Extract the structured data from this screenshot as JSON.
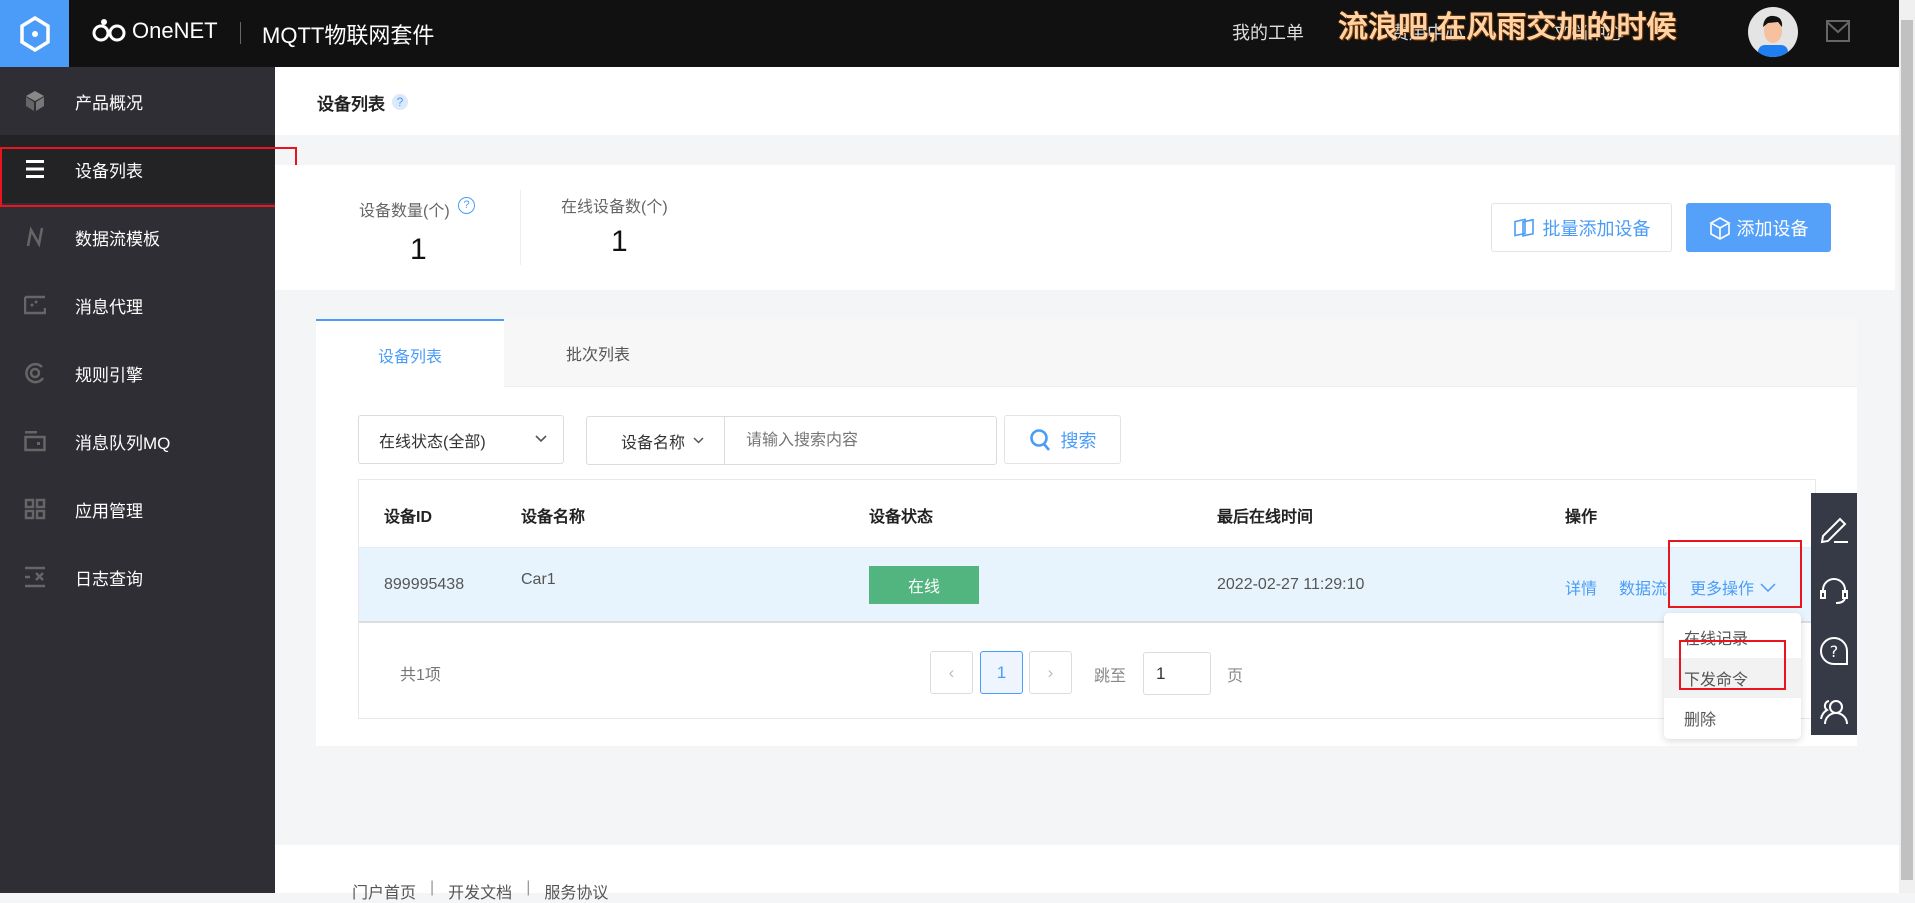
{
  "header": {
    "logo_text": "OneNET",
    "product": "MQTT物联网套件",
    "nav": [
      "我的工单",
      "费用中心",
      "文档中心"
    ],
    "overlay_lyric": "流浪吧,在风雨交加的时候"
  },
  "sidebar": {
    "items": [
      {
        "label": "产品概况",
        "icon": "cube-icon"
      },
      {
        "label": "设备列表",
        "icon": "list-icon"
      },
      {
        "label": "数据流模板",
        "icon": "datastream-icon"
      },
      {
        "label": "消息代理",
        "icon": "message-broker-icon"
      },
      {
        "label": "规则引擎",
        "icon": "rule-engine-icon"
      },
      {
        "label": "消息队列MQ",
        "icon": "queue-icon"
      },
      {
        "label": "应用管理",
        "icon": "apps-grid-icon"
      },
      {
        "label": "日志查询",
        "icon": "log-icon"
      }
    ],
    "active": 1
  },
  "page": {
    "title": "设备列表",
    "help": "?"
  },
  "stats": {
    "device_count_label": "设备数量(个)",
    "device_count": "1",
    "online_count_label": "在线设备数(个)",
    "online_count": "1",
    "batch_add": "批量添加设备",
    "add": "添加设备"
  },
  "tabs": [
    "设备列表",
    "批次列表"
  ],
  "filters": {
    "status_select": "在线状态(全部)",
    "field_select": "设备名称",
    "search_placeholder": "请输入搜索内容",
    "search_button": "搜索"
  },
  "table": {
    "columns": [
      "设备ID",
      "设备名称",
      "设备状态",
      "最后在线时间",
      "操作"
    ],
    "rows": [
      {
        "id": "899995438",
        "name": "Car1",
        "status": "在线",
        "last_online": "2022-02-27 11:29:10",
        "actions": [
          "详情",
          "数据流",
          "更多操作"
        ]
      }
    ]
  },
  "dropdown": {
    "items": [
      "在线记录",
      "下发命令",
      "删除"
    ],
    "hovered": 1
  },
  "pagination": {
    "total": "共1项",
    "current": "1",
    "jump_label": "跳至",
    "jump_value": "1",
    "page_label": "页"
  },
  "footer": {
    "links": [
      "门户首页",
      "开发文档",
      "服务协议"
    ],
    "sep": "|"
  },
  "colors": {
    "primary": "#4a9cf8",
    "online": "#52b47e",
    "sidebar": "#2f2e34",
    "highlight": "#e8141e"
  }
}
